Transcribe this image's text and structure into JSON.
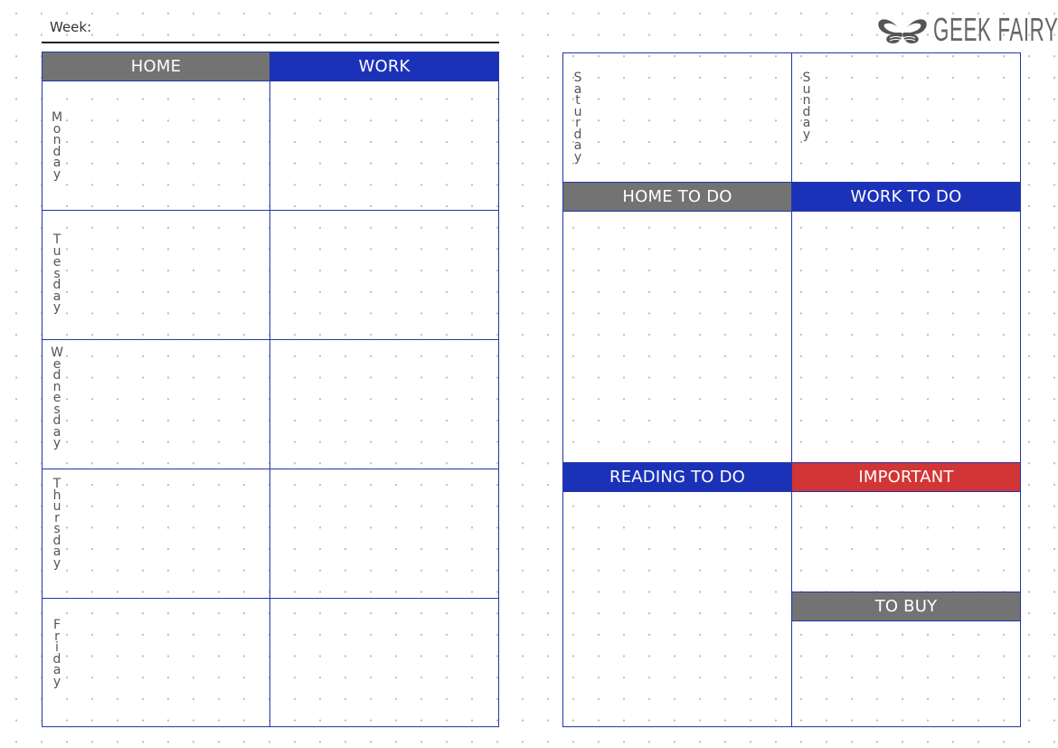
{
  "week": {
    "label": "Week:"
  },
  "brand": {
    "logo_icon": "butterfly-icon",
    "name": "GEEK FAIRY"
  },
  "colors": {
    "border": "#2236a8",
    "blue": "#1b32b8",
    "gray": "#737373",
    "red": "#d23535",
    "dot": "#b9b9b9"
  },
  "left_page": {
    "columns": [
      "HOME",
      "WORK"
    ],
    "days": [
      "Monday",
      "Tuesday",
      "Wednesday",
      "Thursday",
      "Friday"
    ]
  },
  "right_page": {
    "weekend": [
      "Saturday",
      "Sunday"
    ],
    "sections": {
      "home_todo": "HOME TO DO",
      "work_todo": "WORK TO DO",
      "reading_todo": "READING TO DO",
      "important": "IMPORTANT",
      "to_buy": "TO BUY"
    }
  }
}
